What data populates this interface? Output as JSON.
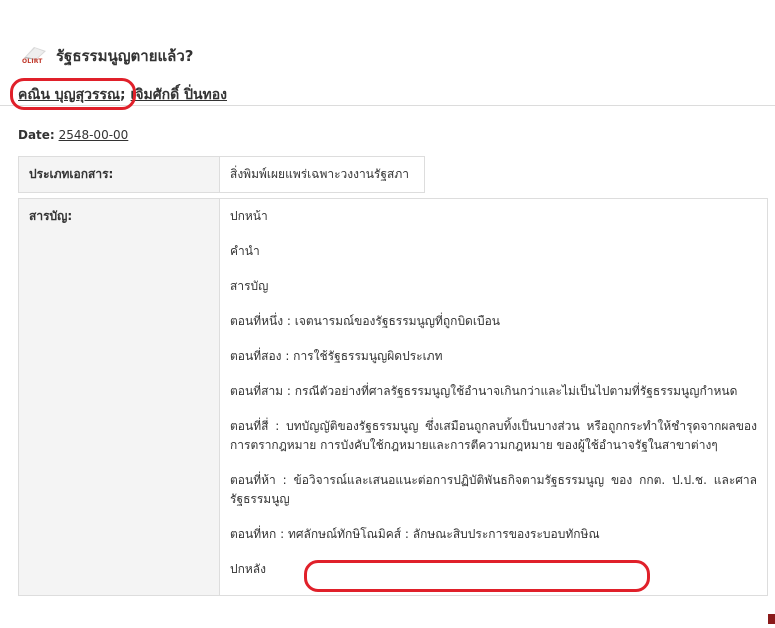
{
  "page": {
    "title": "รัฐธรรมนูญตายแล้ว?",
    "logo_text": "OLIRT",
    "authors": [
      "คณิน บุญสุวรรณ",
      "เจิมศักดิ์ ปิ่นทอง"
    ],
    "author_separator": ";",
    "date_label": "Date:",
    "date_value": "2548-00-00"
  },
  "doc_type": {
    "label": "ประเภทเอกสาร:",
    "value": "สิ่งพิมพ์เผยแพร่เฉพาะวงงานรัฐสภา"
  },
  "toc": {
    "label": "สารบัญ:",
    "items": [
      "ปกหน้า",
      "คำนำ",
      "สารบัญ",
      "ตอนที่หนึ่ง : เจตนารมณ์ของรัฐธรรมนูญที่ถูกบิดเบือน",
      "ตอนที่สอง : การใช้รัฐธรรมนูญผิดประเภท",
      "ตอนที่สาม : กรณีตัวอย่างที่ศาลรัฐธรรมนูญใช้อำนาจเกินกว่าและไม่เป็นไปตามที่รัฐธรรมนูญกำหนด",
      "ตอนที่สี่ : บทบัญญัติของรัฐธรรมนูญ ซึ่งเสมือนถูกลบทิ้งเป็นบางส่วน หรือถูกกระทำให้ชำรุดจากผลของการตรากฎหมาย การบังคับใช้กฎหมายและการตีความกฎหมาย ของผู้ใช้อำนาจรัฐในสาขาต่างๆ",
      "ตอนที่ห้า : ข้อวิจารณ์และเสนอแนะต่อการปฏิบัติพันธกิจตามรัฐธรรมนูญ ของ กกต. ป.ป.ช. และศาลรัฐธรรมนูญ",
      "ตอนที่หก : ทศลักษณ์ทักษิโณมิคส์ : ลักษณะสิบประการของระบอบทักษิณ",
      "ปกหลัง"
    ]
  },
  "colors": {
    "annotation_red": "#e0202a",
    "label_bg": "#f4f4f4",
    "border": "#dddddd"
  }
}
